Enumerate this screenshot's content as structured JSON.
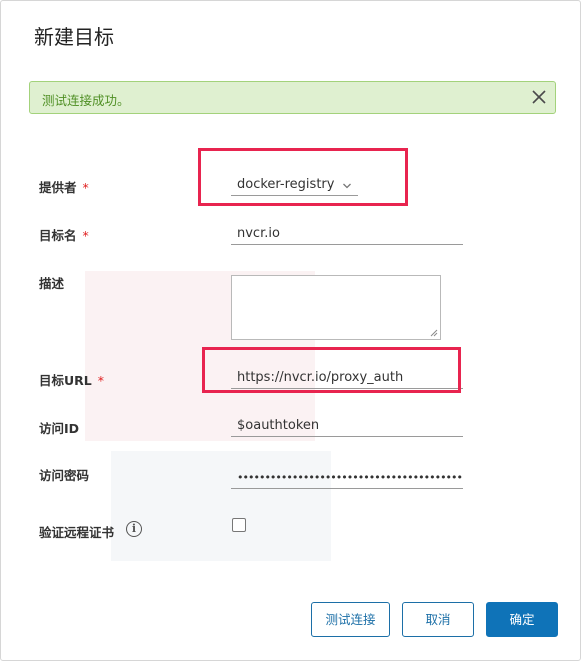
{
  "dialog": {
    "title": "新建目标"
  },
  "alert": {
    "message": "测试连接成功。"
  },
  "form": {
    "provider": {
      "label": "提供者",
      "required_mark": "*",
      "value": "docker-registry"
    },
    "target_name": {
      "label": "目标名",
      "required_mark": "*",
      "value": "nvcr.io"
    },
    "description": {
      "label": "描述",
      "value": ""
    },
    "target_url": {
      "label": "目标URL",
      "required_mark": "*",
      "value": "https://nvcr.io/proxy_auth"
    },
    "access_id": {
      "label": "访问ID",
      "value": "$oauthtoken"
    },
    "access_secret": {
      "label": "访问密码",
      "value": "••••••••••••••••••••••••••••••••••••••••••••••"
    },
    "verify_cert": {
      "label": "验证远程证书",
      "checked": false,
      "info_glyph": "i"
    }
  },
  "buttons": {
    "test_label": "测试连接",
    "cancel_label": "取消",
    "ok_label": "确定"
  },
  "colors": {
    "alert_bg": "#dff0d0",
    "alert_text": "#4f8f24",
    "highlight": "#e8244f",
    "primary": "#0f73b8",
    "required": "#e02020"
  },
  "icons": {
    "alert_close": "close-icon",
    "select": "chevron-down-icon",
    "verify_info": "info-icon"
  }
}
